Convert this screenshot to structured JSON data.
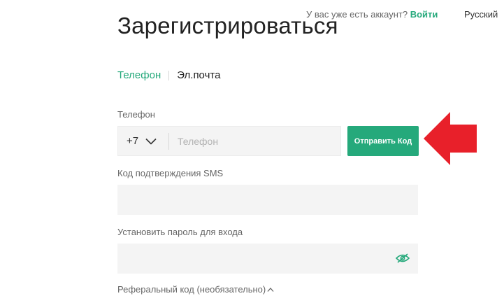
{
  "header": {
    "have_account": "У вас уже есть аккаунт?",
    "login_link": "Войти",
    "language": "Русский"
  },
  "title": "Зарегистрироваться",
  "tabs": [
    {
      "label": "Телефон",
      "active": true
    },
    {
      "label": "Эл.почта",
      "active": false
    }
  ],
  "phone": {
    "label": "Телефон",
    "country_code": "+7",
    "placeholder": "Телефон",
    "value": ""
  },
  "send_code_button": "Отправить Код",
  "sms_code": {
    "label": "Код подтверждения SMS",
    "value": ""
  },
  "password": {
    "label": "Установить пароль для входа",
    "value": ""
  },
  "referral": {
    "label": "Реферальный код (необязательно)"
  },
  "colors": {
    "accent": "#25a97b",
    "arrow": "#e8202a",
    "field_bg": "#f4f4f4"
  }
}
